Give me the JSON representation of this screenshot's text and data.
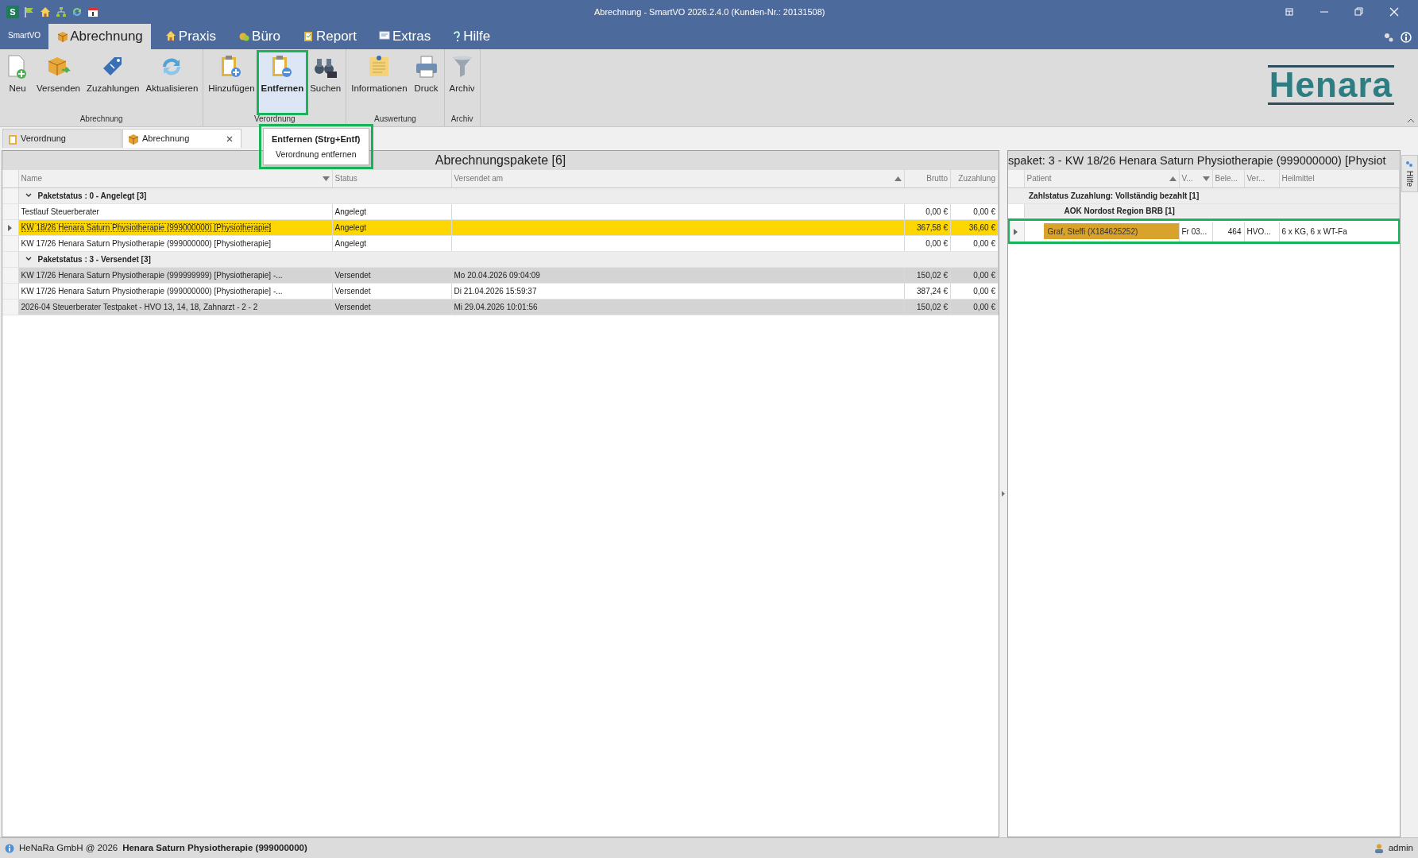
{
  "window": {
    "title": "Abrechnung - SmartVO 2026.2.4.0 (Kunden-Nr.: 20131508)",
    "app_letter": "S"
  },
  "ribbon": {
    "app_tab": "SmartVO",
    "tabs": [
      {
        "label": "Abrechnung",
        "selected": true
      },
      {
        "label": "Praxis",
        "selected": false
      },
      {
        "label": "Büro",
        "selected": false
      },
      {
        "label": "Report",
        "selected": false
      },
      {
        "label": "Extras",
        "selected": false
      },
      {
        "label": "Hilfe",
        "selected": false
      }
    ],
    "groups": [
      {
        "label": "Abrechnung",
        "buttons": [
          {
            "label": "Neu",
            "highlighted": false
          },
          {
            "label": "Versenden",
            "highlighted": false
          },
          {
            "label": "Zuzahlungen",
            "highlighted": false
          },
          {
            "label": "Aktualisieren",
            "highlighted": false
          }
        ]
      },
      {
        "label": "Verordnung",
        "buttons": [
          {
            "label": "Hinzufügen",
            "highlighted": false
          },
          {
            "label": "Entfernen",
            "highlighted": true
          },
          {
            "label": "Suchen",
            "highlighted": false
          }
        ]
      },
      {
        "label": "Auswertung",
        "buttons": [
          {
            "label": "Informationen",
            "highlighted": false
          },
          {
            "label": "Druck",
            "highlighted": false
          }
        ]
      },
      {
        "label": "Archiv",
        "buttons": [
          {
            "label": "Archiv",
            "highlighted": false
          }
        ]
      }
    ],
    "logo": "Henara"
  },
  "doc_tabs": [
    {
      "label": "Verordnung",
      "selected": false
    },
    {
      "label": "Abrechnung",
      "selected": true
    }
  ],
  "tooltip": {
    "title": "Entfernen (Strg+Entf)",
    "text": "Verordnung entfernen",
    "highlighted": true
  },
  "packages": {
    "title": "Abrechnungspakete [6]",
    "columns": [
      {
        "label": "Name",
        "sort_ascending": false,
        "sort_descending": true
      },
      {
        "label": "Status",
        "sort_ascending": false,
        "sort_descending": false
      },
      {
        "label": "Versendet am",
        "sort_ascending": true,
        "sort_descending": false
      },
      {
        "label": "Brutto",
        "sort_ascending": false,
        "sort_descending": false
      },
      {
        "label": "Zuzahlung",
        "sort_ascending": false,
        "sort_descending": false
      }
    ],
    "groups": [
      {
        "label": "Paketstatus : 0 - Angelegt [3]",
        "expanded": true,
        "rows": [
          {
            "cells": [
              "Testlauf Steuerberater",
              "Angelegt",
              "",
              "0,00 €",
              "0,00 €"
            ],
            "focused": false,
            "shaded": false
          },
          {
            "cells": [
              "KW 18/26  Henara Saturn Physiotherapie (999000000) [Physiotherapie]",
              "Angelegt",
              "",
              "367,58 €",
              "36,60 €"
            ],
            "focused": true,
            "shaded": false
          },
          {
            "cells": [
              "KW 17/26  Henara Saturn Physiotherapie (999000000) [Physiotherapie]",
              "Angelegt",
              "",
              "0,00 €",
              "0,00 €"
            ],
            "focused": false,
            "shaded": false
          }
        ]
      },
      {
        "label": "Paketstatus : 3 - Versendet [3]",
        "expanded": true,
        "rows": [
          {
            "cells": [
              "KW 17/26  Henara Saturn Physiotherapie (999999999) [Physiotherapie] -...",
              "Versendet",
              "Mo 20.04.2026 09:04:09",
              "150,02 €",
              "0,00 €"
            ],
            "focused": false,
            "shaded": true
          },
          {
            "cells": [
              "KW 17/26  Henara Saturn Physiotherapie (999000000) [Physiotherapie] -...",
              "Versendet",
              "Di 21.04.2026 15:59:37",
              "387,24 €",
              "0,00 €"
            ],
            "focused": false,
            "shaded": false
          },
          {
            "cells": [
              "2026-04 Steuerberater Testpaket - HVO 13, 14, 18, Zahnarzt - 2 - 2",
              "Versendet",
              "Mi 29.04.2026 10:01:56",
              "150,02 €",
              "0,00 €"
            ],
            "focused": false,
            "shaded": true
          }
        ]
      }
    ]
  },
  "detail": {
    "title": "spaket: 3 - KW 18/26  Henara Saturn Physiotherapie (999000000) [Physiot",
    "columns": [
      {
        "label": "Patient",
        "sort_ascending": true,
        "sort_descending": false
      },
      {
        "label": "V...",
        "sort_ascending": false,
        "sort_descending": true
      },
      {
        "label": "Bele...",
        "sort_ascending": false,
        "sort_descending": false
      },
      {
        "label": "Ver...",
        "sort_ascending": false,
        "sort_descending": false
      },
      {
        "label": "Heilmittel",
        "sort_ascending": false,
        "sort_descending": false
      }
    ],
    "group": {
      "label": "Zahlstatus Zuzahlung: Vollständig bezahlt [1]",
      "children": [
        {
          "label": "AOK Nordost Region BRB  [1]",
          "rows": [
            {
              "cells": [
                "Graf, Steffi (X184625252)",
                "Fr 03...",
                "464",
                "HVO...",
                "6 x KG, 6 x WT-Fa"
              ],
              "focused": true,
              "highlighted": true
            }
          ]
        }
      ]
    }
  },
  "side_tab": {
    "label": "Hilfe"
  },
  "status_bar": {
    "copyright": "HeNaRa GmbH @ 2026",
    "practice": "Henara Saturn Physiotherapie (999000000)",
    "user": "admin"
  }
}
